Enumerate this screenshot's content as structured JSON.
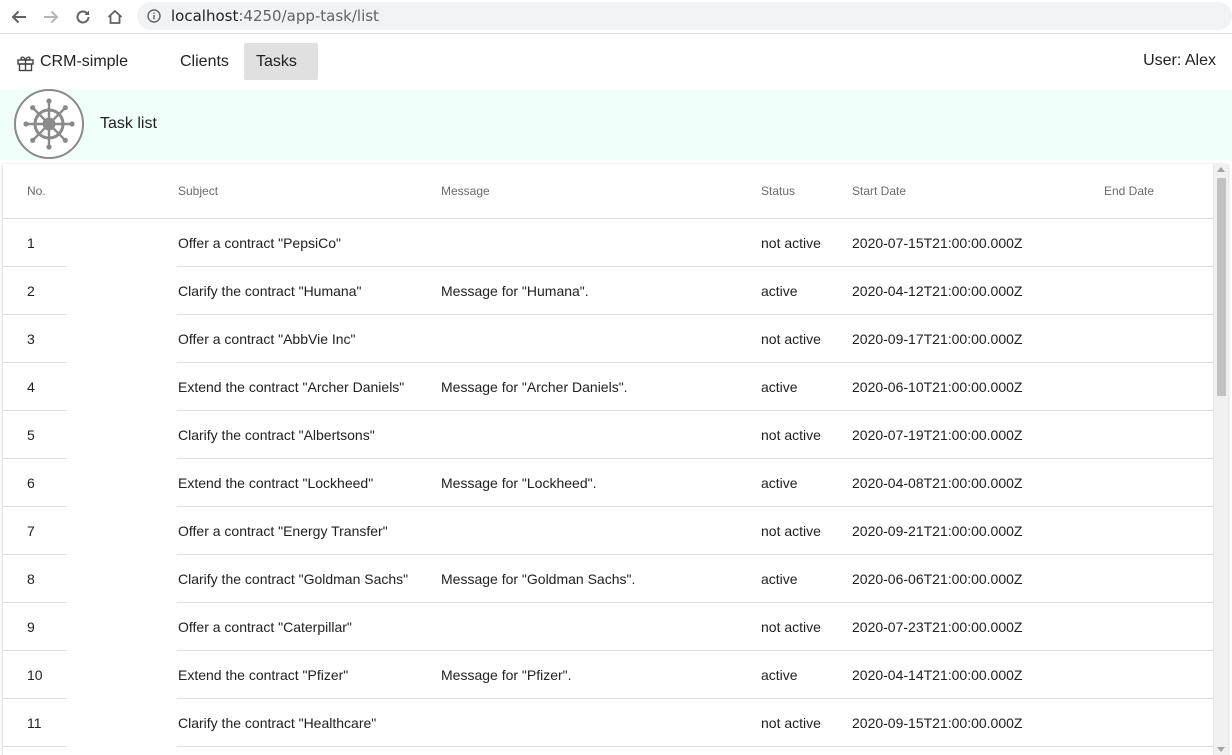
{
  "browser": {
    "url_host": "localhost",
    "url_path": ":4250/app-task/list",
    "icons": [
      "back-icon",
      "forward-icon",
      "reload-icon",
      "home-icon",
      "info-icon"
    ]
  },
  "header": {
    "brand": "CRM-simple",
    "brand_icon": "gift-icon",
    "nav": [
      {
        "label": "Clients",
        "active": false
      },
      {
        "label": "Tasks",
        "active": true
      }
    ],
    "user": "User: Alex"
  },
  "banner": {
    "title": "Task list",
    "logo_icon": "ship-wheel-icon",
    "background": "#f0fff9"
  },
  "table": {
    "columns": [
      "No.",
      "Subject",
      "Message",
      "Status",
      "Start Date",
      "End Date"
    ],
    "rows": [
      {
        "no": "1",
        "subject": "Offer a contract \"PepsiCo\"",
        "message": "",
        "status": "not active",
        "start": "2020-07-15T21:00:00.000Z",
        "end": ""
      },
      {
        "no": "2",
        "subject": "Clarify the contract \"Humana\"",
        "message": "Message for \"Humana\".",
        "status": "active",
        "start": "2020-04-12T21:00:00.000Z",
        "end": ""
      },
      {
        "no": "3",
        "subject": "Offer a contract \"AbbVie Inc\"",
        "message": "",
        "status": "not active",
        "start": "2020-09-17T21:00:00.000Z",
        "end": ""
      },
      {
        "no": "4",
        "subject": "Extend the contract \"Archer Daniels\"",
        "message": "Message for \"Archer Daniels\".",
        "status": "active",
        "start": "2020-06-10T21:00:00.000Z",
        "end": ""
      },
      {
        "no": "5",
        "subject": "Clarify the contract \"Albertsons\"",
        "message": "",
        "status": "not active",
        "start": "2020-07-19T21:00:00.000Z",
        "end": ""
      },
      {
        "no": "6",
        "subject": "Extend the contract \"Lockheed\"",
        "message": "Message for \"Lockheed\".",
        "status": "active",
        "start": "2020-04-08T21:00:00.000Z",
        "end": ""
      },
      {
        "no": "7",
        "subject": "Offer a contract \"Energy Transfer\"",
        "message": "",
        "status": "not active",
        "start": "2020-09-21T21:00:00.000Z",
        "end": ""
      },
      {
        "no": "8",
        "subject": "Clarify the contract \"Goldman Sachs\"",
        "message": "Message for \"Goldman Sachs\".",
        "status": "active",
        "start": "2020-06-06T21:00:00.000Z",
        "end": ""
      },
      {
        "no": "9",
        "subject": "Offer a contract \"Caterpillar\"",
        "message": "",
        "status": "not active",
        "start": "2020-07-23T21:00:00.000Z",
        "end": ""
      },
      {
        "no": "10",
        "subject": "Extend the contract \"Pfizer\"",
        "message": "Message for \"Pfizer\".",
        "status": "active",
        "start": "2020-04-14T21:00:00.000Z",
        "end": ""
      },
      {
        "no": "11",
        "subject": "Clarify the contract \"Healthcare\"",
        "message": "",
        "status": "not active",
        "start": "2020-09-15T21:00:00.000Z",
        "end": ""
      }
    ]
  }
}
